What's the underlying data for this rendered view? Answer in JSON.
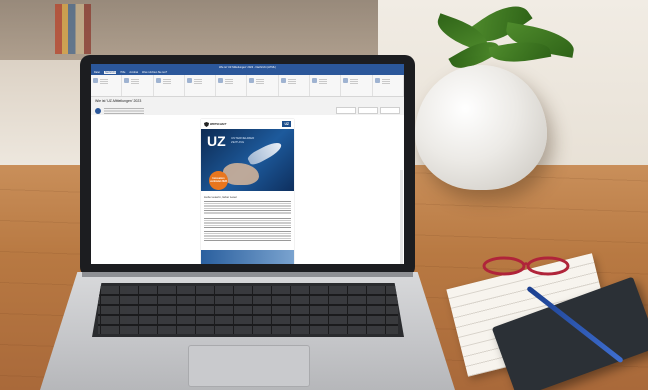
{
  "app": {
    "window_title": "Wie ist 'UZ Mitteilungen' 2023 - Nachricht (HTML)",
    "menu_tabs": [
      "Datei",
      "Nachricht",
      "Hilfe",
      "Acrobat",
      "Was möchten Sie tun?"
    ],
    "active_tab_index": 1,
    "subject": "Wie ist 'UZ-Mitteilungen' 2023"
  },
  "newsletter": {
    "logo_text": "WIRTSCHAFT",
    "uz_badge": "UZ",
    "hero_title": "UZ",
    "hero_subtitle": "UNTERNEHMER ZEITUNG",
    "badge_text": "Innovation verbindet 2023",
    "greeting": "Liebe Leserin, lieber Leser"
  },
  "colors": {
    "outlook_blue": "#2b579a",
    "hero_blue": "#1d5a9c",
    "badge_orange": "#e8761e"
  }
}
